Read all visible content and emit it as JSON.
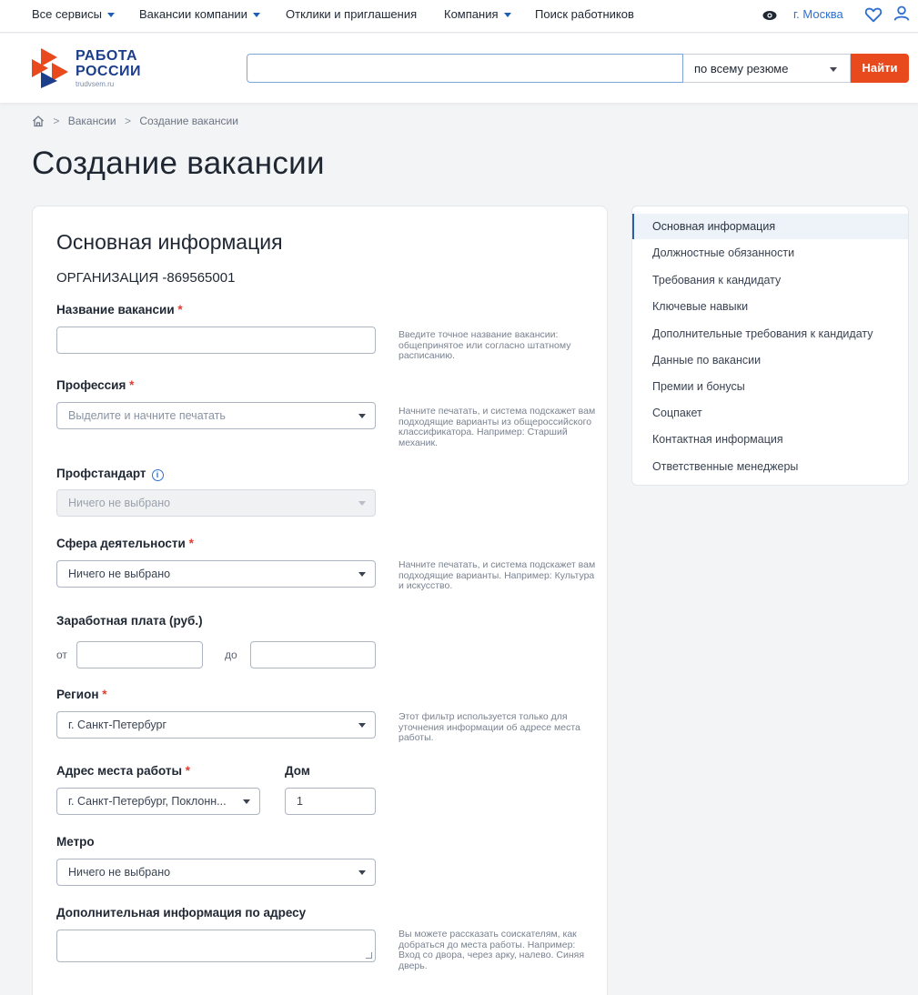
{
  "topnav": {
    "items": [
      "Все сервисы",
      "Вакансии компании",
      "Отклики и приглашения",
      "Компания",
      "Поиск работников"
    ],
    "city": "г. Москва"
  },
  "logo": {
    "line1": "РАБОТА",
    "line2": "РОССИИ",
    "sub": "trudvsem.ru"
  },
  "search": {
    "value": "",
    "scope": "по всему резюме",
    "button": "Найти"
  },
  "breadcrumb": [
    "Вакансии",
    "Создание вакансии"
  ],
  "page_title": "Создание вакансии",
  "form": {
    "section_title": "Основная информация",
    "organization": "ОРГАНИЗАЦИЯ -869565001",
    "vacancy_name": {
      "label": "Название вакансии",
      "value": "",
      "hint": "Введите точное название вакансии: общепринятое или согласно штатному расписанию."
    },
    "profession": {
      "label": "Профессия",
      "placeholder": "Выделите и начните печатать",
      "hint": "Начните печатать, и система подскажет вам подходящие варианты из общероссийского классификатора. Например: Старший механик."
    },
    "profstandard": {
      "label": "Профстандарт",
      "info": "i",
      "value": "Ничего не выбрано"
    },
    "sphere": {
      "label": "Сфера деятельности",
      "value": "Ничего не выбрано",
      "hint": "Начните печатать, и система подскажет вам подходящие варианты. Например: Культура и искусство."
    },
    "salary": {
      "label": "Заработная плата (руб.)",
      "from": "от",
      "to": "до"
    },
    "region": {
      "label": "Регион",
      "value": "г. Санкт-Петербург",
      "hint": "Этот фильтр используется только для уточнения информации об адресе места работы."
    },
    "address": {
      "label": "Адрес места работы",
      "value": "г. Санкт-Петербург, Поклонн..."
    },
    "house": {
      "label": "Дом",
      "value": "1"
    },
    "metro": {
      "label": "Метро",
      "value": "Ничего не выбрано"
    },
    "extra_address": {
      "label": "Дополнительная информация по адресу",
      "hint": "Вы можете рассказать соискателям, как добраться до места работы. Например: Вход со двора, через арку, налево. Синяя дверь."
    },
    "required_mark": "*"
  },
  "sidebar": {
    "items": [
      "Основная информация",
      "Должностные обязанности",
      "Требования к кандидату",
      "Ключевые навыки",
      "Дополнительные требования к кандидату",
      "Данные по вакансии",
      "Премии и бонусы",
      "Соцпакет",
      "Контактная информация",
      "Ответственные менеджеры"
    ]
  },
  "colors": {
    "accent": "#e8491d",
    "brand": "#1d3e8b",
    "link": "#2f6fd1",
    "required": "#e03c31"
  }
}
